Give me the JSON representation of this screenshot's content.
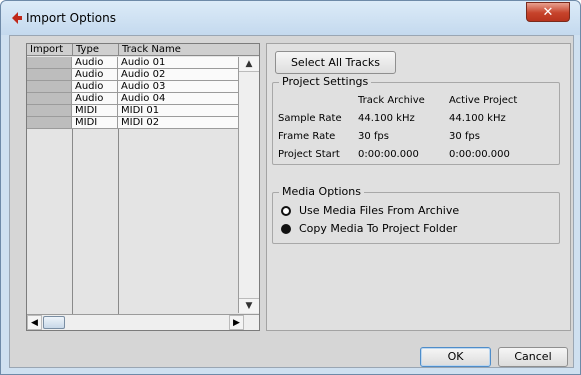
{
  "window": {
    "title": "Import Options",
    "close_glyph": "✕"
  },
  "table": {
    "headers": {
      "import": "Import",
      "type": "Type",
      "name": "Track Name"
    },
    "rows": [
      {
        "type": "Audio",
        "name": "Audio 01"
      },
      {
        "type": "Audio",
        "name": "Audio 02"
      },
      {
        "type": "Audio",
        "name": "Audio 03"
      },
      {
        "type": "Audio",
        "name": "Audio 04"
      },
      {
        "type": "MIDI",
        "name": "MIDI 01"
      },
      {
        "type": "MIDI",
        "name": "MIDI 02"
      }
    ]
  },
  "buttons": {
    "select_all": "Select All Tracks",
    "ok": "OK",
    "cancel": "Cancel"
  },
  "project_settings": {
    "title": "Project Settings",
    "col_archive": "Track Archive",
    "col_project": "Active Project",
    "rows": [
      {
        "label": "Sample Rate",
        "archive": "44.100 kHz",
        "project": "44.100 kHz"
      },
      {
        "label": "Frame Rate",
        "archive": "30 fps",
        "project": "30 fps"
      },
      {
        "label": "Project Start",
        "archive": "0:00:00.000",
        "project": "0:00:00.000"
      }
    ]
  },
  "media_options": {
    "title": "Media Options",
    "options": [
      {
        "label": "Use Media Files From Archive",
        "selected": false
      },
      {
        "label": "Copy Media To Project Folder",
        "selected": true
      }
    ]
  },
  "colors": {
    "accent": "#c6432b",
    "titlebar": "#cfe0f0"
  }
}
